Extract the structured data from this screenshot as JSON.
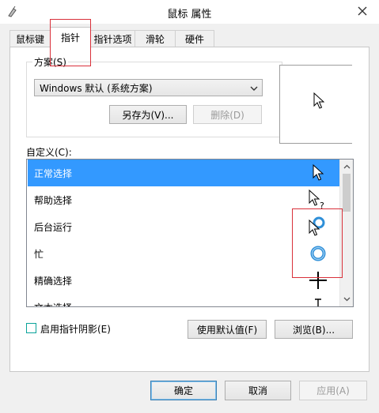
{
  "window": {
    "title": "鼠标 属性",
    "close_icon": "close-icon",
    "app_icon": "mouse-icon"
  },
  "tabs": [
    {
      "label": "鼠标键"
    },
    {
      "label": "指针",
      "active": true
    },
    {
      "label": "指针选项"
    },
    {
      "label": "滑轮"
    },
    {
      "label": "硬件"
    }
  ],
  "scheme": {
    "label": "方案(S)",
    "selected": "Windows 默认 (系统方案)",
    "save_as_label": "另存为(V)...",
    "delete_label": "删除(D)"
  },
  "custom": {
    "label": "自定义(C):",
    "items": [
      {
        "label": "正常选择",
        "icon": "arrow-cursor-icon",
        "selected": true
      },
      {
        "label": "帮助选择",
        "icon": "help-cursor-icon"
      },
      {
        "label": "后台运行",
        "icon": "working-in-background-cursor-icon"
      },
      {
        "label": "忙",
        "icon": "busy-cursor-icon"
      },
      {
        "label": "精确选择",
        "icon": "precision-crosshair-cursor-icon"
      },
      {
        "label": "文本选择",
        "icon": "text-ibeam-cursor-icon"
      }
    ]
  },
  "shadow": {
    "label": "启用指针阴影(E)",
    "checked": false
  },
  "actions": {
    "use_default_label": "使用默认值(F)",
    "browse_label": "浏览(B)..."
  },
  "footer": {
    "ok_label": "确定",
    "cancel_label": "取消",
    "apply_label": "应用(A)"
  },
  "colors": {
    "selection": "#3399ff",
    "highlight_box": "#d9303a",
    "busy_ring": "#2f8fd8"
  }
}
